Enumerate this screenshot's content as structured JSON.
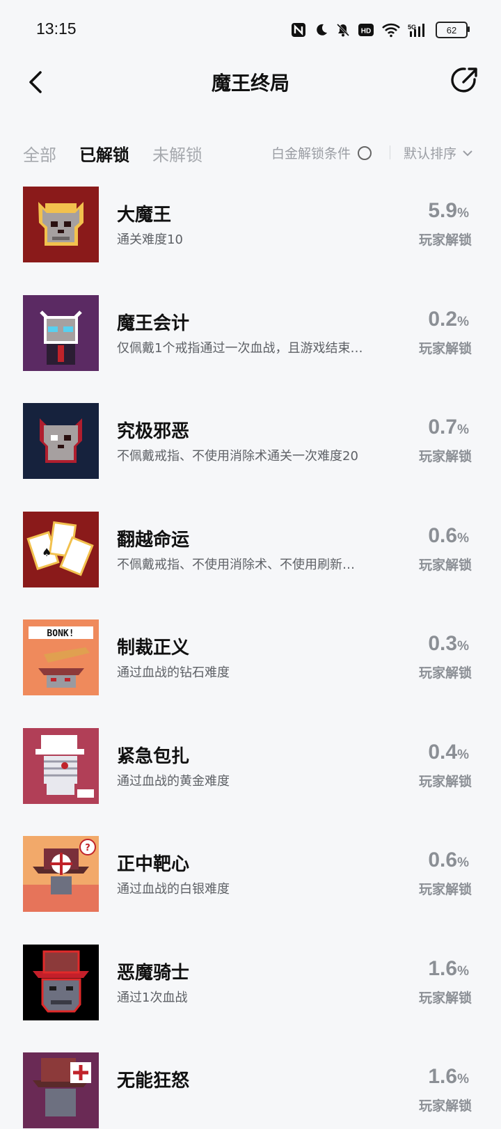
{
  "status": {
    "time": "13:15",
    "battery": "62"
  },
  "nav": {
    "title": "魔王终局"
  },
  "filter": {
    "tabs": [
      "全部",
      "已解锁",
      "未解锁"
    ],
    "active_tab": "已解锁",
    "platinum_condition": "白金解锁条件",
    "sort": "默认排序"
  },
  "achievements": [
    {
      "title": "大魔王",
      "desc": "通关难度10",
      "percent": "5.9",
      "unit": "%",
      "label": "玩家解锁",
      "bg": "#8a1a1a"
    },
    {
      "title": "魔王会计",
      "desc": "仅佩戴1个戒指通过一次血战，且游戏结束…",
      "percent": "0.2",
      "unit": "%",
      "label": "玩家解锁",
      "bg": "#5b2a63"
    },
    {
      "title": "究极邪恶",
      "desc": "不佩戴戒指、不使用消除术通关一次难度20",
      "percent": "0.7",
      "unit": "%",
      "label": "玩家解锁",
      "bg": "#16223d"
    },
    {
      "title": "翻越命运",
      "desc": "不佩戴戒指、不使用消除术、不使用刷新…",
      "percent": "0.6",
      "unit": "%",
      "label": "玩家解锁",
      "bg": "#8a1a1a"
    },
    {
      "title": "制裁正义",
      "desc": "通过血战的钻石难度",
      "percent": "0.3",
      "unit": "%",
      "label": "玩家解锁",
      "bg": "#ef8a5c"
    },
    {
      "title": "紧急包扎",
      "desc": "通过血战的黄金难度",
      "percent": "0.4",
      "unit": "%",
      "label": "玩家解锁",
      "bg": "#b13f57"
    },
    {
      "title": "正中靶心",
      "desc": "通过血战的白银难度",
      "percent": "0.6",
      "unit": "%",
      "label": "玩家解锁",
      "bg": "#f2a96a"
    },
    {
      "title": "恶魔骑士",
      "desc": "通过1次血战",
      "percent": "1.6",
      "unit": "%",
      "label": "玩家解锁",
      "bg": "#000000"
    },
    {
      "title": "无能狂怒",
      "desc": "",
      "percent": "1.6",
      "unit": "%",
      "label": "玩家解锁",
      "bg": "#6a2a55"
    }
  ]
}
